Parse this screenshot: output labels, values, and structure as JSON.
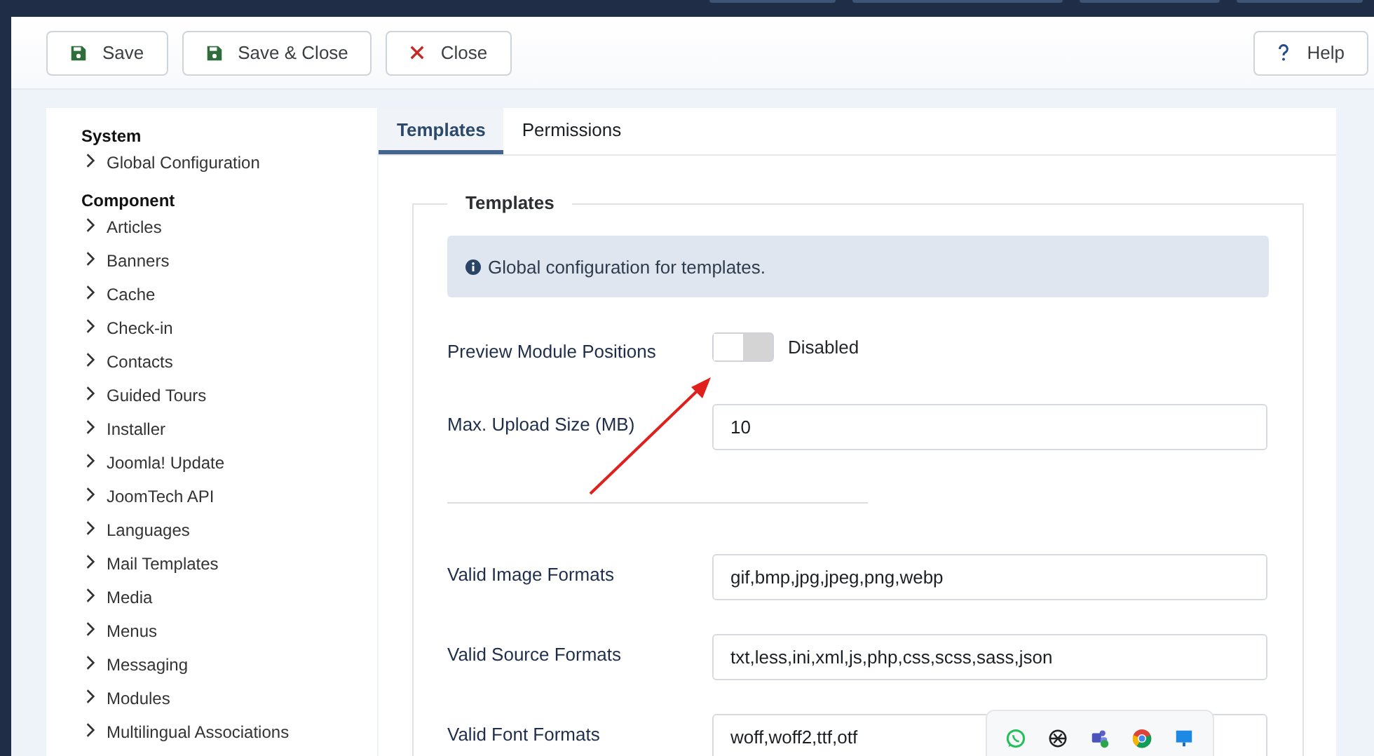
{
  "toolbar": {
    "buttons": [
      {
        "kind": "save",
        "label": "Save"
      },
      {
        "kind": "save",
        "label": "Save & Close"
      },
      {
        "kind": "close",
        "label": "Close"
      }
    ],
    "help": {
      "label": "Help"
    }
  },
  "sidebar": {
    "sections": [
      {
        "title": "System",
        "items": [
          "Global Configuration"
        ]
      },
      {
        "title": "Component",
        "items": [
          "Articles",
          "Banners",
          "Cache",
          "Check-in",
          "Contacts",
          "Guided Tours",
          "Installer",
          "Joomla! Update",
          "JoomTech API",
          "Languages",
          "Mail Templates",
          "Media",
          "Menus",
          "Messaging",
          "Modules",
          "Multilingual Associations"
        ]
      }
    ]
  },
  "tabs": [
    {
      "label": "Templates",
      "selected": true
    },
    {
      "label": "Permissions",
      "selected": false
    }
  ],
  "fieldset": {
    "legend": "Templates",
    "info": "Global configuration for templates.",
    "fields": [
      {
        "kind": "toggle",
        "label": "Preview Module Positions",
        "on": false,
        "value": "Disabled"
      },
      {
        "kind": "text",
        "label": "Max. Upload Size (MB)",
        "value": "10"
      },
      {
        "kind": "divider"
      },
      {
        "kind": "text",
        "label": "Valid Image Formats",
        "value": "gif,bmp,jpg,jpeg,png,webp"
      },
      {
        "kind": "text",
        "label": "Valid Source Formats",
        "value": "txt,less,ini,xml,js,php,css,scss,sass,json"
      },
      {
        "kind": "text",
        "label": "Valid Font Formats",
        "value": "woff,woff2,ttf,otf"
      }
    ]
  }
}
